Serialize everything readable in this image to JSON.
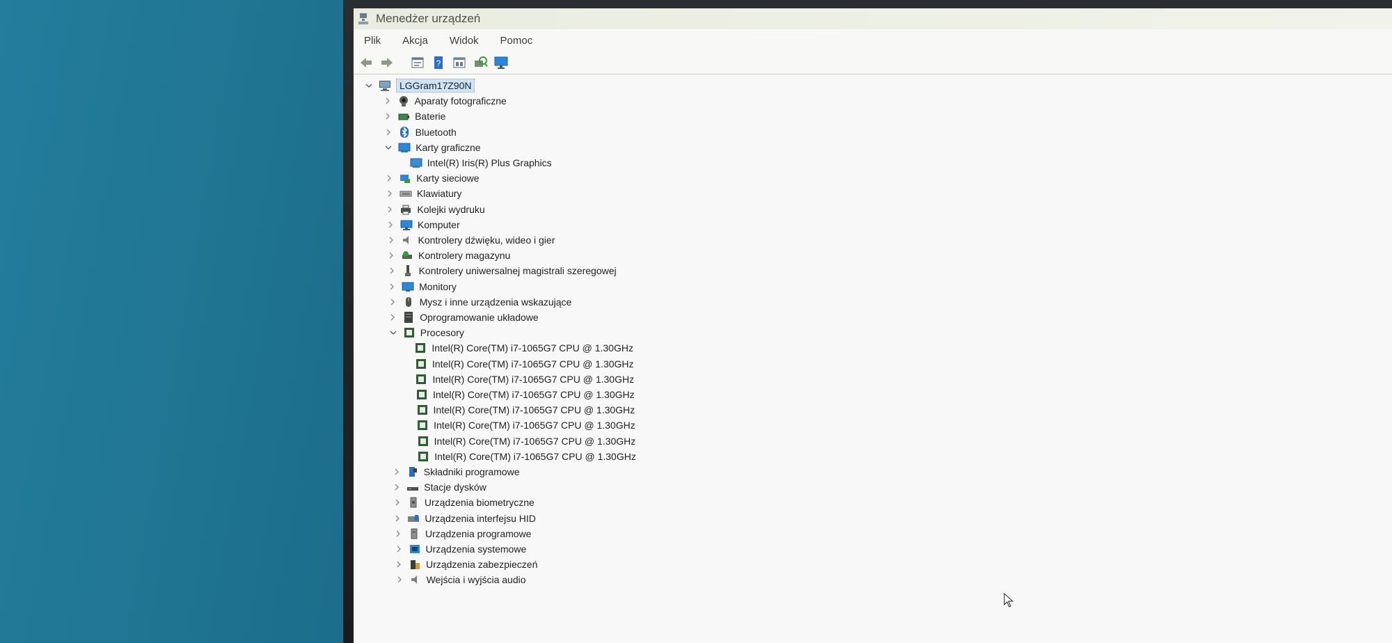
{
  "window": {
    "title": "Menedżer urządzeń",
    "menu": [
      "Plik",
      "Akcja",
      "Widok",
      "Pomoc"
    ]
  },
  "toolbar": {
    "buttons": [
      "back-icon",
      "forward-icon",
      "properties-icon",
      "help-icon",
      "view-icon",
      "scan-icon",
      "monitor-icon"
    ]
  },
  "tree": {
    "root": "LGGram17Z90N",
    "categories": [
      {
        "label": "Aparaty fotograficzne",
        "icon": "camera-icon",
        "expanded": false
      },
      {
        "label": "Baterie",
        "icon": "battery-icon",
        "expanded": false
      },
      {
        "label": "Bluetooth",
        "icon": "bluetooth-icon",
        "expanded": false
      },
      {
        "label": "Karty graficzne",
        "icon": "display-adapter-icon",
        "expanded": true,
        "children": [
          "Intel(R) Iris(R) Plus Graphics"
        ]
      },
      {
        "label": "Karty sieciowe",
        "icon": "network-icon",
        "expanded": false
      },
      {
        "label": "Klawiatury",
        "icon": "keyboard-icon",
        "expanded": false
      },
      {
        "label": "Kolejki wydruku",
        "icon": "printer-icon",
        "expanded": false
      },
      {
        "label": "Komputer",
        "icon": "computer-icon",
        "expanded": false
      },
      {
        "label": "Kontrolery dźwięku, wideo i gier",
        "icon": "sound-icon",
        "expanded": false
      },
      {
        "label": "Kontrolery magazynu",
        "icon": "storage-controller-icon",
        "expanded": false
      },
      {
        "label": "Kontrolery uniwersalnej magistrali szeregowej",
        "icon": "usb-icon",
        "expanded": false
      },
      {
        "label": "Monitory",
        "icon": "monitor-icon",
        "expanded": false
      },
      {
        "label": "Mysz i inne urządzenia wskazujące",
        "icon": "mouse-icon",
        "expanded": false
      },
      {
        "label": "Oprogramowanie układowe",
        "icon": "firmware-icon",
        "expanded": false
      },
      {
        "label": "Procesory",
        "icon": "processor-icon",
        "expanded": true,
        "children": [
          "Intel(R) Core(TM) i7-1065G7 CPU @ 1.30GHz",
          "Intel(R) Core(TM) i7-1065G7 CPU @ 1.30GHz",
          "Intel(R) Core(TM) i7-1065G7 CPU @ 1.30GHz",
          "Intel(R) Core(TM) i7-1065G7 CPU @ 1.30GHz",
          "Intel(R) Core(TM) i7-1065G7 CPU @ 1.30GHz",
          "Intel(R) Core(TM) i7-1065G7 CPU @ 1.30GHz",
          "Intel(R) Core(TM) i7-1065G7 CPU @ 1.30GHz",
          "Intel(R) Core(TM) i7-1065G7 CPU @ 1.30GHz"
        ]
      },
      {
        "label": "Składniki programowe",
        "icon": "software-component-icon",
        "expanded": false
      },
      {
        "label": "Stacje dysków",
        "icon": "disk-drive-icon",
        "expanded": false
      },
      {
        "label": "Urządzenia biometryczne",
        "icon": "biometric-icon",
        "expanded": false
      },
      {
        "label": "Urządzenia interfejsu HID",
        "icon": "hid-icon",
        "expanded": false
      },
      {
        "label": "Urządzenia programowe",
        "icon": "software-device-icon",
        "expanded": false
      },
      {
        "label": "Urządzenia systemowe",
        "icon": "system-device-icon",
        "expanded": false
      },
      {
        "label": "Urządzenia zabezpieczeń",
        "icon": "security-device-icon",
        "expanded": false
      },
      {
        "label": "Wejścia i wyjścia audio",
        "icon": "audio-io-icon",
        "expanded": false
      }
    ]
  },
  "colors": {
    "desktop": "#1b6c88",
    "window_bg": "#f7f8f7",
    "selection": "#cfe3f7",
    "accent": "#2b88d8"
  }
}
